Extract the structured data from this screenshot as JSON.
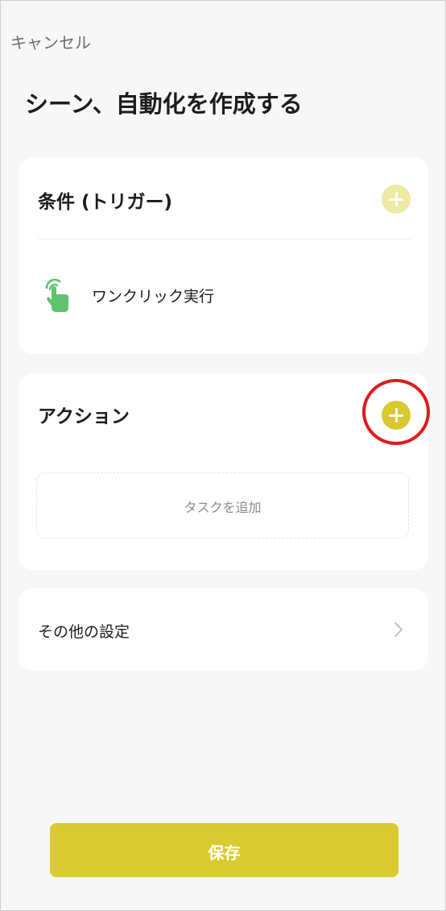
{
  "header": {
    "cancel_label": "キャンセル",
    "title": "シーン、自動化を作成する"
  },
  "condition_card": {
    "title": "条件 (トリガー)",
    "trigger": {
      "label": "ワンクリック実行",
      "icon": "tap-hand-icon"
    }
  },
  "action_card": {
    "title": "アクション",
    "task_placeholder": "タスクを追加"
  },
  "other_card": {
    "label": "その他の設定"
  },
  "footer": {
    "save_label": "保存"
  },
  "colors": {
    "accent": "#d9c92e",
    "accent_light": "#eee9a3",
    "highlight": "#e01b1b",
    "trigger_icon": "#5ec46e"
  }
}
